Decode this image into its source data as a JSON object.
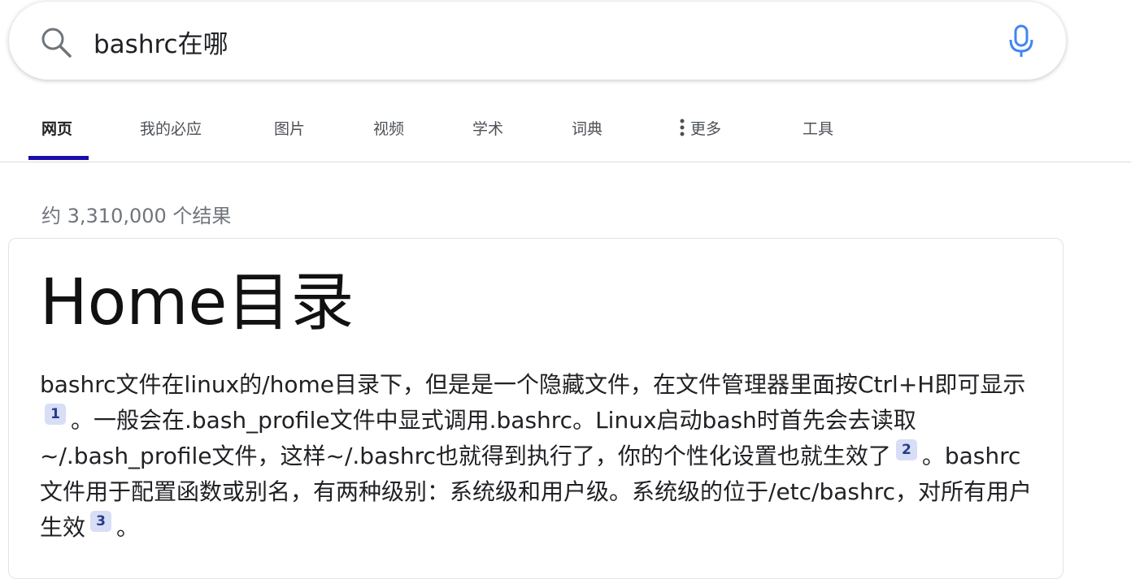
{
  "search": {
    "query": "bashrc在哪",
    "search_icon": "search-icon",
    "mic_icon": "microphone-icon"
  },
  "tabs": [
    {
      "label": "网页",
      "active": true
    },
    {
      "label": "我的必应"
    },
    {
      "label": "图片"
    },
    {
      "label": "视频"
    },
    {
      "label": "学术"
    },
    {
      "label": "词典"
    },
    {
      "label": "更多",
      "icon": "more-vertical-icon"
    },
    {
      "label": "工具"
    }
  ],
  "results": {
    "count_text": "约 3,310,000 个结果"
  },
  "answer": {
    "title": "Home目录",
    "segments": [
      "bashrc文件在linux的/home目录下，但是是一个隐藏文件，在文件管理器里面按Ctrl+H即可显示",
      "。一般会在.bash_profile文件中显式调用.bashrc。Linux启动bash时首先会去读取~/.bash_profile文件，这样~/.bashrc也就得到执行了，你的个性化设置也就生效了",
      "。bashrc文件用于配置函数或别名，有两种级别：系统级和用户级。系统级的位于/etc/bashrc，对所有用户生效",
      "。"
    ],
    "citations": [
      "1",
      "2",
      "3"
    ]
  },
  "colors": {
    "active_tab_underline": "#1a0dab",
    "mic_blue": "#4285f4",
    "citation_bg": "#d7def6"
  }
}
